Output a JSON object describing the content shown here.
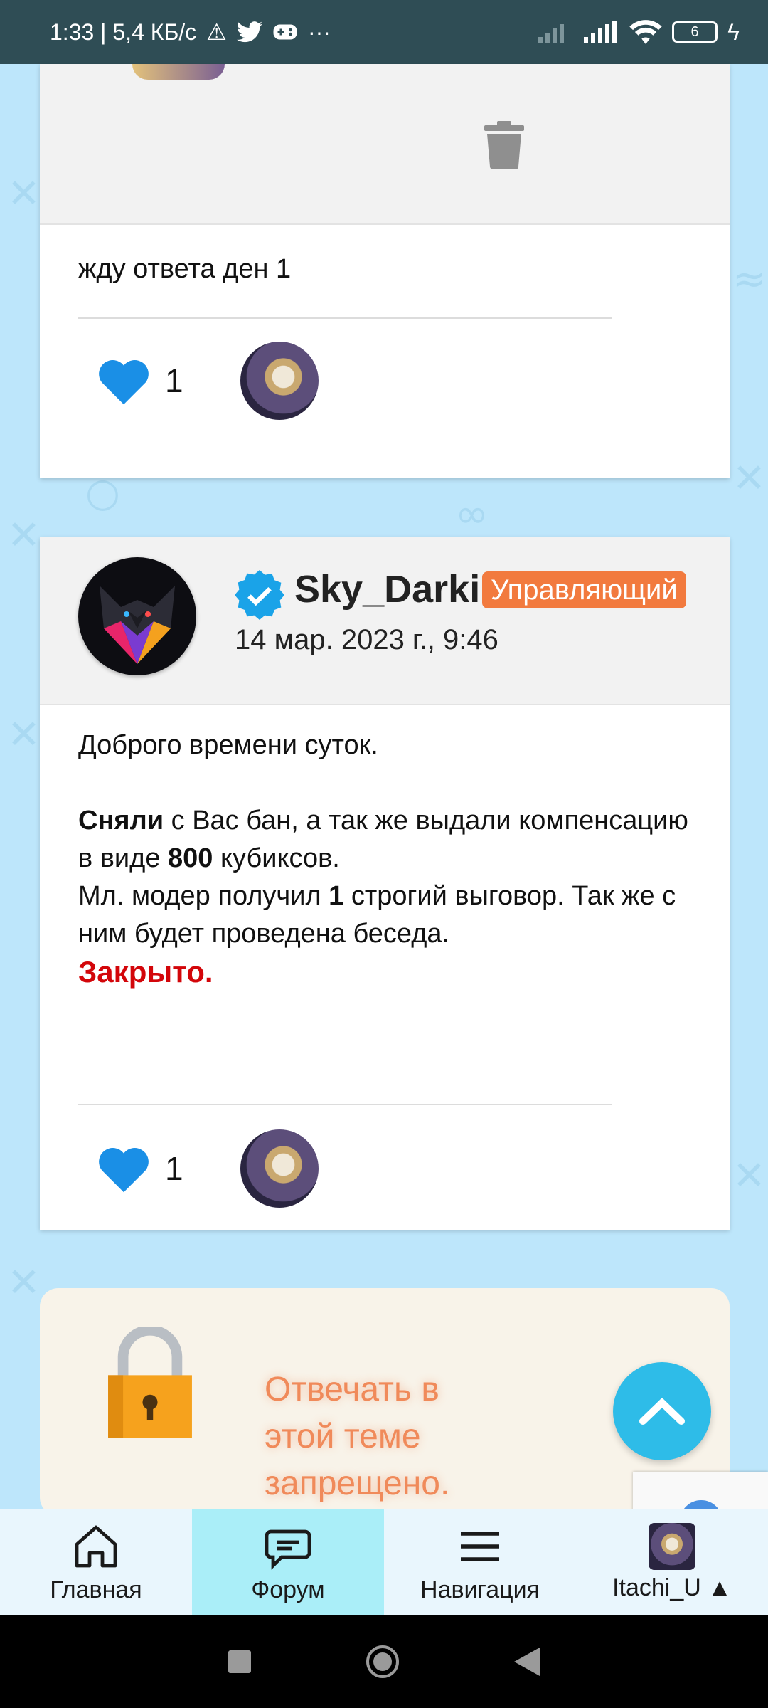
{
  "status_bar": {
    "time_speed": "1:33 | 5,4 КБ/с",
    "battery": "6"
  },
  "posts": [
    {
      "body": "жду ответа ден 1",
      "likes": "1"
    },
    {
      "author": "Sky_Darki",
      "role": "Управляющий",
      "date": "14 мар. 2023 г., 9:46",
      "greeting": "Доброго времени суток.",
      "line1_bold": "Сняли",
      "line1_rest": " с Вас бан, а так же выдали компенсацию в виде ",
      "line1_number": "800",
      "line1_end": " кубиксов.",
      "line2_start": "Мл. модер получил ",
      "line2_number": "1",
      "line2_end": " строгий выговор. Так же с ним будет проведена беседа.",
      "closed": "Закрыто.",
      "likes": "1"
    }
  ],
  "locked_notice": "Отвечать в этой теме запрещено.",
  "bottom_nav": {
    "home": "Главная",
    "forum": "Форум",
    "navigation": "Навигация",
    "profile": "Itachi_U"
  },
  "colors": {
    "accent": "#2ebce8",
    "badge": "#f27a3e",
    "closed": "#d3060a",
    "heart": "#1a8fe6"
  }
}
